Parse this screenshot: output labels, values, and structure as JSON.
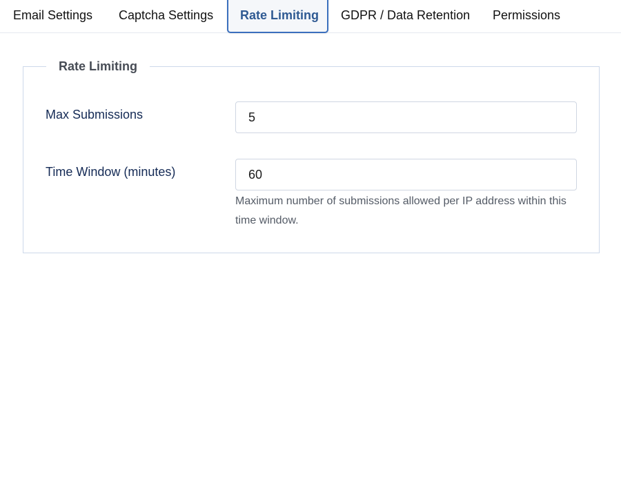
{
  "tabs": [
    {
      "label": "Email Settings"
    },
    {
      "label": "Captcha Settings"
    },
    {
      "label": "Rate Limiting"
    },
    {
      "label": "GDPR / Data Retention"
    },
    {
      "label": "Permissions"
    }
  ],
  "active_tab": "Rate Limiting",
  "fieldset": {
    "legend": "Rate Limiting",
    "max_submissions": {
      "label": "Max Submissions",
      "value": "5"
    },
    "time_window": {
      "label": "Time Window (minutes)",
      "value": "60",
      "help": "Maximum number of submissions allowed per IP address within this time window."
    }
  },
  "colors": {
    "accent": "#3a6fbd",
    "active_tab_text": "#2f5a93",
    "label_text": "#142a55",
    "fieldset_border": "#cdd8ea"
  }
}
